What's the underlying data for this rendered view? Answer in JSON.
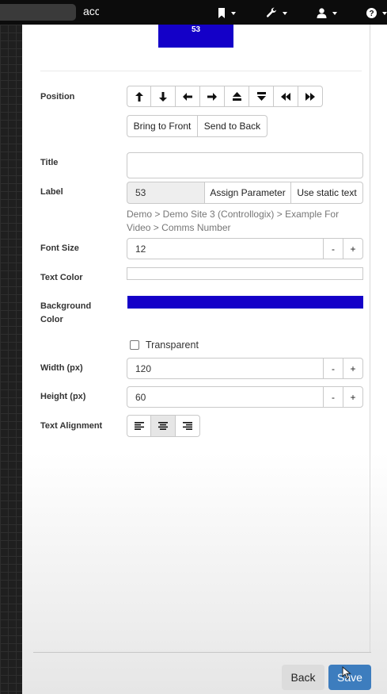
{
  "navbar": {
    "search_text": "acc",
    "icons": [
      "bookmark-icon",
      "wrench-icon",
      "user-icon",
      "help-icon"
    ]
  },
  "preview": {
    "label": "53",
    "color": "#1400c8"
  },
  "form": {
    "position": {
      "label": "Position",
      "arrows": [
        "up",
        "down",
        "left",
        "right",
        "up-to-top",
        "down-to-bottom",
        "fast-backward",
        "fast-forward"
      ],
      "bring_to_front": "Bring to Front",
      "send_to_back": "Send to Back"
    },
    "title": {
      "label": "Title",
      "value": ""
    },
    "label_field": {
      "label": "Label",
      "value": "53",
      "assign_parameter": "Assign Parameter",
      "use_static_text": "Use static text",
      "path": "Demo > Demo Site 3 (Controllogix) > Example For Video > Comms Number"
    },
    "font_size": {
      "label": "Font Size",
      "value": "12",
      "minus": "-",
      "plus": "+"
    },
    "text_color": {
      "label": "Text Color",
      "value": ""
    },
    "background_color": {
      "label": "Background Color",
      "value": "#1400c8"
    },
    "transparent": {
      "label": "Transparent",
      "checked": false
    },
    "width": {
      "label": "Width (px)",
      "value": "120",
      "minus": "-",
      "plus": "+"
    },
    "height": {
      "label": "Height (px)",
      "value": "60",
      "minus": "-",
      "plus": "+"
    },
    "text_alignment": {
      "label": "Text Alignment",
      "options": [
        "left",
        "center",
        "right"
      ],
      "selected": "center"
    }
  },
  "footer": {
    "back_label": "Back",
    "save_label": "Save"
  }
}
